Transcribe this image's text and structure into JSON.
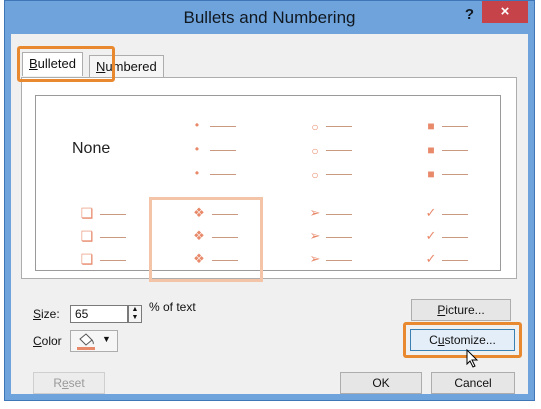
{
  "window": {
    "title": "Bullets and Numbering",
    "help": "?",
    "close": "×"
  },
  "tabs": {
    "bulleted": {
      "prefix": "B",
      "rest": "ulleted"
    },
    "numbered": {
      "prefix": "N",
      "rest": "umbered"
    }
  },
  "gallery": {
    "none_label": "None",
    "selected_style": "hollow-diamond bullets",
    "bullet_color": "#e8896a"
  },
  "size": {
    "label_prefix": "S",
    "label_rest": "ize:",
    "value": "65",
    "suffix": "% of text"
  },
  "color": {
    "label_prefix": "C",
    "label_rest": "olor"
  },
  "buttons": {
    "picture": {
      "prefix": "P",
      "rest": "icture..."
    },
    "customize": {
      "pre": "C",
      "u": "u",
      "rest": "stomize..."
    },
    "reset": {
      "pre": "R",
      "u": "e",
      "rest": "set"
    },
    "ok": "OK",
    "cancel": "Cancel"
  },
  "colors": {
    "highlight": "#e8892f",
    "close_bg": "#c7434a",
    "title_bg": "#6fa3dc"
  }
}
